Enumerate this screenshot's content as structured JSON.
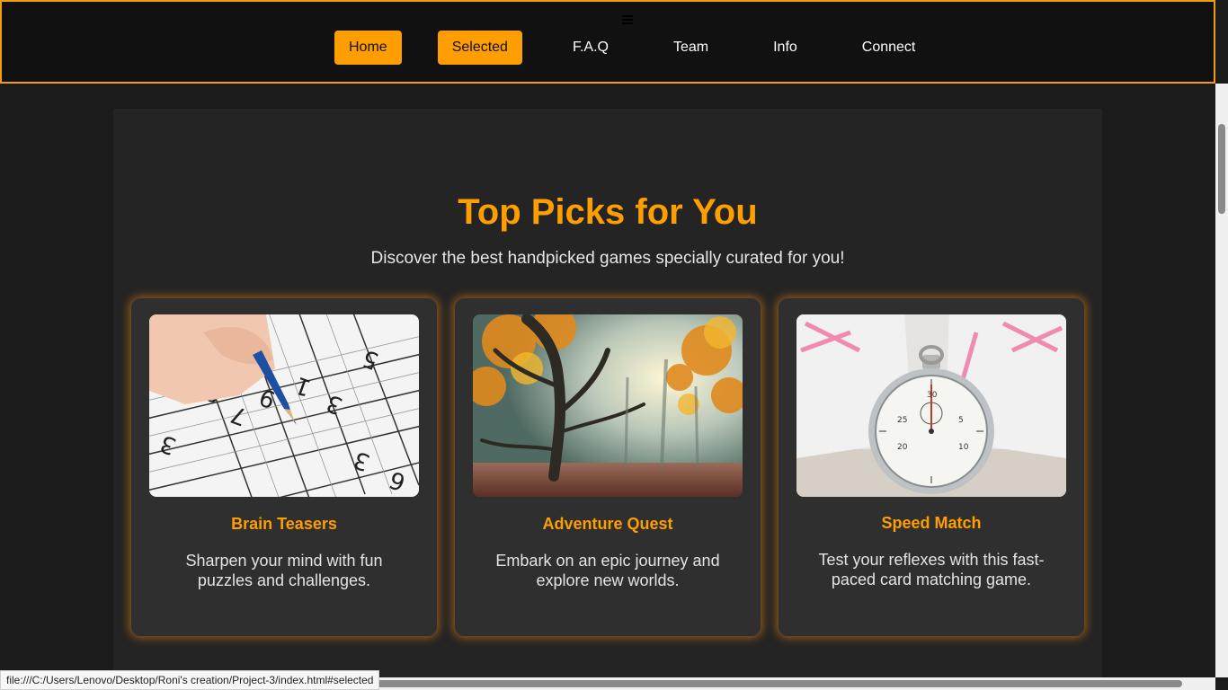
{
  "nav": {
    "items": [
      {
        "label": "Home"
      },
      {
        "label": "Selected"
      },
      {
        "label": "F.A.Q"
      },
      {
        "label": "Team"
      },
      {
        "label": "Info"
      },
      {
        "label": "Connect"
      }
    ],
    "active_color": "#ff9e00",
    "border_color": "#f39c12"
  },
  "hero": {
    "title": "Top Picks for You",
    "subtitle": "Discover the best handpicked games specially curated for you!"
  },
  "cards": [
    {
      "title": "Brain Teasers",
      "description": "Sharpen your mind with fun puzzles and challenges.",
      "image": "sudoku-puzzle-image"
    },
    {
      "title": "Adventure Quest",
      "description": "Embark on an epic journey and explore new worlds.",
      "image": "autumn-forest-image"
    },
    {
      "title": "Speed Match",
      "description": "Test your reflexes with this fast-paced card matching game.",
      "image": "stopwatch-image"
    }
  ],
  "status_bar": {
    "url": "file:///C:/Users/Lenovo/Desktop/Roni's creation/Project-3/index.html#selected"
  }
}
